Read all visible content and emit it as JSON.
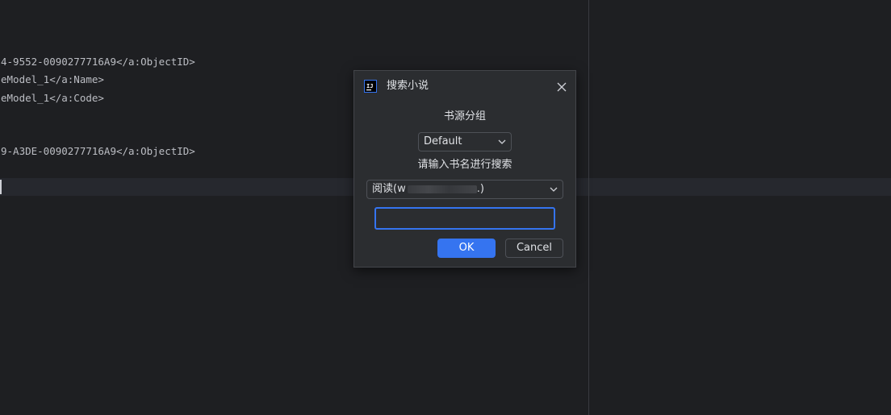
{
  "editor": {
    "lines": [
      "4-9552-0090277716A9</a:ObjectID>",
      "eModel_1</a:Name>",
      "eModel_1</a:Code>",
      "9-A3DE-0090277716A9</a:ObjectID>"
    ]
  },
  "dialog": {
    "title": "搜索小说",
    "app_icon": "intellij-idea-icon",
    "source_group_label": "书源分组",
    "source_group_value": "Default",
    "search_prompt": "请输入书名进行搜索",
    "source_value_prefix": "阅读(w",
    "source_value_suffix": ".)",
    "search_input_value": "",
    "ok_label": "OK",
    "cancel_label": "Cancel"
  },
  "colors": {
    "accent": "#3574f0",
    "dialog_bg": "#2b2d30",
    "editor_bg": "#1e1f22"
  }
}
